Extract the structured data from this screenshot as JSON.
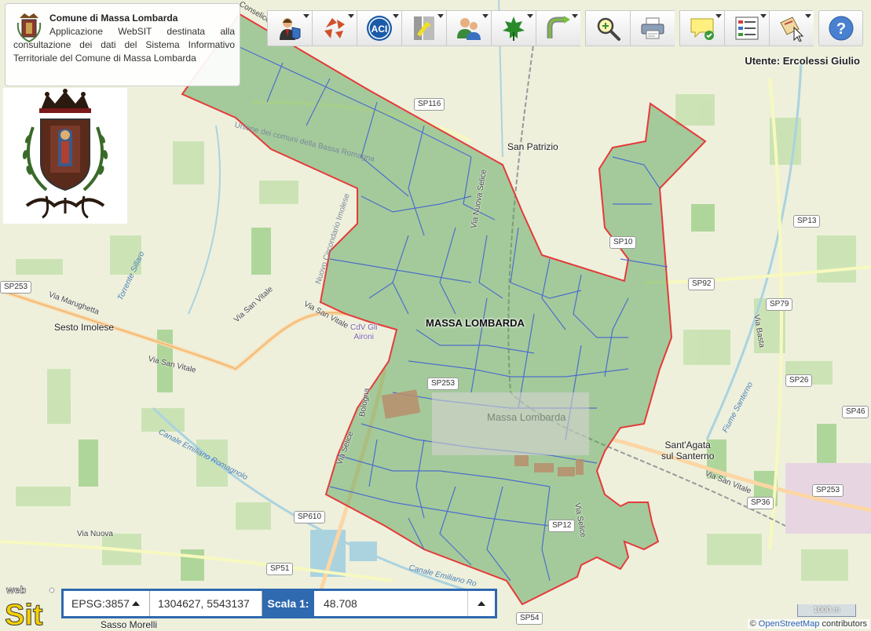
{
  "app": {
    "title": "Comune di Massa Lombarda",
    "description": "Applicazione WebSIT destinata alla consultazione dei dati del Sistema Informativo Territoriale del Comune di Massa Lombarda",
    "user_label": "Utente: Ercolessi Giulio"
  },
  "toolbar": {
    "buttons": [
      {
        "icon": "user-admin-icon",
        "has_menu": true
      },
      {
        "icon": "cadastre-icon",
        "has_menu": true
      },
      {
        "icon": "aci-icon",
        "has_menu": true
      },
      {
        "icon": "roads-icon",
        "has_menu": true
      },
      {
        "icon": "users-group-icon",
        "has_menu": true
      },
      {
        "icon": "leaf-icon",
        "has_menu": true
      },
      {
        "icon": "route-icon",
        "has_menu": true
      },
      {
        "icon": "zoom-search-icon",
        "has_menu": false
      },
      {
        "icon": "print-icon",
        "has_menu": false
      },
      {
        "icon": "note-icon",
        "has_menu": true
      },
      {
        "icon": "legend-icon",
        "has_menu": true
      },
      {
        "icon": "select-icon",
        "has_menu": true
      },
      {
        "icon": "help-icon",
        "has_menu": false
      }
    ]
  },
  "map": {
    "labels": {
      "municipality": "MASSA LOMBARDA",
      "town_massa": "Massa Lombarda",
      "san_patrizio": "San Patrizio",
      "sesto_imolese": "Sesto Imolese",
      "santagata": "Sant'Agata\nsul Santerno",
      "cdv": "CdV Gli\nAironi",
      "sasso_morelli": "Sasso Morelli",
      "union": "Unione dei comuni della Bassa Romagna",
      "circondario": "Nuovo Circondario Imolese",
      "conselice_top": "Conselice"
    },
    "roads": {
      "sp116": "SP116",
      "sp13": "SP13",
      "sp10": "SP10",
      "sp92": "SP92",
      "sp79": "SP79",
      "sp26": "SP26",
      "sp46": "SP46",
      "sp253_left": "SP253",
      "sp253_right": "SP253",
      "sp36": "SP36",
      "sp253_mid": "SP253",
      "sp610": "SP610",
      "sp51": "SP51",
      "sp54": "SP54",
      "sp12": "SP12",
      "sp253_town": "SP253"
    },
    "road_names": {
      "via_marughetta": "Via Marughetta",
      "via_san_vitale_1": "Via San Vitale",
      "via_san_vitale_2": "Via San Vitale",
      "via_san_vitale_3": "Via San Vitale",
      "via_san_vitale_4": "Via San Vitale",
      "via_nuova": "Via Nuova",
      "via_selice": "Via Selice",
      "via_basta": "Via Basta",
      "bologna": "Bologna",
      "via_nuova_selice": "Via Nuova Selice",
      "via_selice_2": "Via Selice"
    },
    "water_names": {
      "torrente_sillaro": "Torrente Sillaro",
      "canale_emiliano": "Canale Emiliano Romagnolo",
      "canale_emiliano_2": "Canale Emiliano Ro",
      "fiume_santerno": "Fiume Santerno"
    }
  },
  "status_bar": {
    "srs": "EPSG:3857",
    "coordinates": "1304627, 5543137",
    "scale_label": "Scala 1:",
    "scale_value": "48.708"
  },
  "scalebar": "1000 m",
  "attribution": {
    "prefix": "©",
    "link": "OpenStreetMap",
    "suffix": "contributors"
  },
  "colors": {
    "accent": "#2f69b0",
    "boundary": "#e53a3a",
    "parcel": "#3e5fd4",
    "municipality_fill": "#5aa35a"
  }
}
